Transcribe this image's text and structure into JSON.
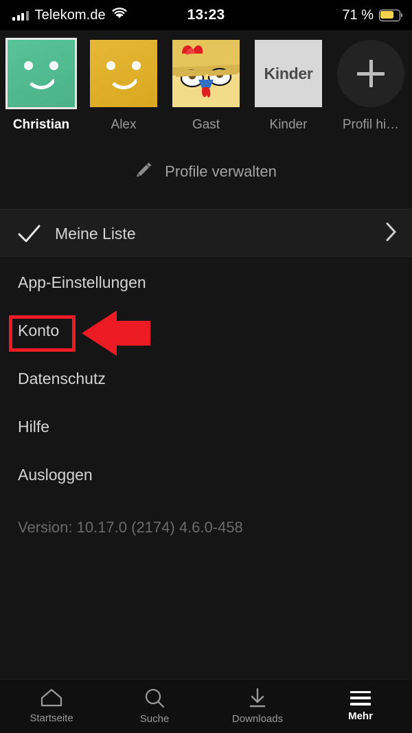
{
  "status_bar": {
    "carrier": "Telekom.de",
    "signal_icon": "cellular-bars-icon",
    "wifi_icon": "wifi-icon",
    "time": "13:23",
    "battery_percent_label": "71 %",
    "battery_level": 71,
    "battery_icon": "battery-icon",
    "battery_color": "#f5d34e"
  },
  "profiles": {
    "items": [
      {
        "name": "Christian",
        "avatar": "smiley-green-avatar",
        "color": "#57c496",
        "selected": true
      },
      {
        "name": "Alex",
        "avatar": "smiley-yellow-avatar",
        "color": "#e6b837",
        "selected": false
      },
      {
        "name": "Gast",
        "avatar": "chicken-avatar",
        "color": "#f0d97a",
        "selected": false
      },
      {
        "name": "Kinder",
        "avatar": "kinder-avatar",
        "color": "#d8d8d8",
        "selected": false,
        "avatar_text": "Kinder"
      },
      {
        "name": "Profil hi…",
        "avatar": "add-profile-icon",
        "color": "#232323",
        "selected": false
      }
    ],
    "manage": {
      "label": "Profile verwalten",
      "icon": "pencil-icon"
    }
  },
  "my_list": {
    "label": "Meine Liste",
    "icon": "check-icon",
    "chevron": "chevron-right-icon"
  },
  "menu": {
    "items": [
      {
        "label": "App-Einstellungen"
      },
      {
        "label": "Konto",
        "highlighted": true
      },
      {
        "label": "Datenschutz"
      },
      {
        "label": "Hilfe"
      },
      {
        "label": "Ausloggen"
      }
    ],
    "version": "Version: 10.17.0 (2174) 4.6.0-458"
  },
  "annotation": {
    "shape": "red-box-and-arrow",
    "color": "#ed1c24",
    "target": "Konto"
  },
  "tab_bar": {
    "items": [
      {
        "label": "Startseite",
        "icon": "home-icon",
        "active": false
      },
      {
        "label": "Suche",
        "icon": "search-icon",
        "active": false
      },
      {
        "label": "Downloads",
        "icon": "download-icon",
        "active": false
      },
      {
        "label": "Mehr",
        "icon": "hamburger-icon",
        "active": true
      }
    ]
  }
}
